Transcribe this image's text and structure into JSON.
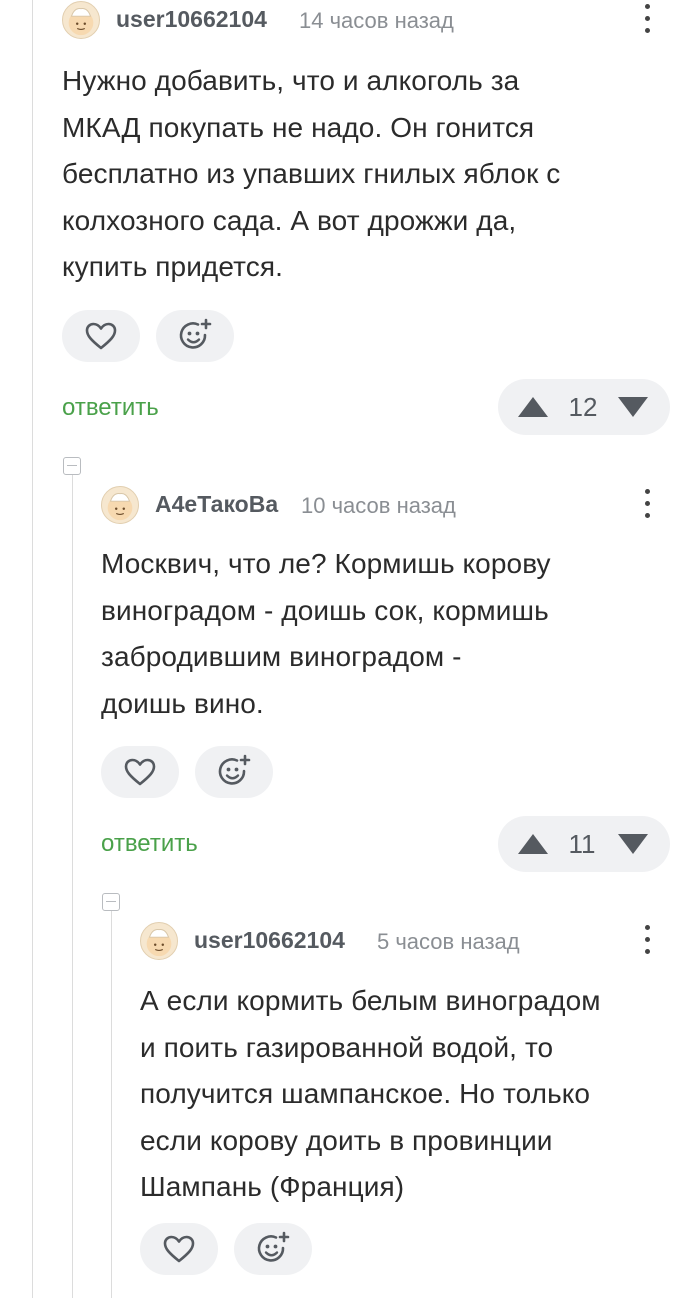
{
  "comments": [
    {
      "username": "user10662104",
      "time": "14 часов назад",
      "text_lines": [
        "Нужно добавить, что и алкоголь за",
        "МКАД покупать не надо. Он гонится",
        "бесплатно из упавших гнилых яблок с",
        "колхозного сада. А вот дрожжи да,",
        "купить придется."
      ],
      "reply_label": "ответить",
      "votes": "12",
      "avatar_icon": "avatar-hat-icon"
    },
    {
      "username": "А4еТакоВа",
      "time": "10 часов назад",
      "text_lines": [
        "Москвич, что ле? Кормишь корову",
        "виноградом - доишь сок, кормишь",
        "забродившим виноградом -",
        "доишь вино."
      ],
      "reply_label": "ответить",
      "votes": "11",
      "avatar_icon": "avatar-hat-icon"
    },
    {
      "username": "user10662104",
      "time": "5 часов назад",
      "text_lines": [
        "А если кормить белым виноградом",
        "и поить газированной водой, то",
        "получится шампанское. Но только",
        "если корову доить в провинции",
        "Шампань (Франция)"
      ],
      "avatar_icon": "avatar-hat-icon"
    }
  ],
  "icons": {
    "like": "heart-icon",
    "react": "smiley-plus-icon",
    "upvote": "triangle-up-icon",
    "downvote": "triangle-down-icon",
    "menu": "more-vertical-icon",
    "collapse": "collapse-minus-icon"
  },
  "colors": {
    "reply": "#4aa14a",
    "pill_bg": "#f0f1f3",
    "text": "#2b2b2b",
    "muted": "#8a8e93"
  }
}
